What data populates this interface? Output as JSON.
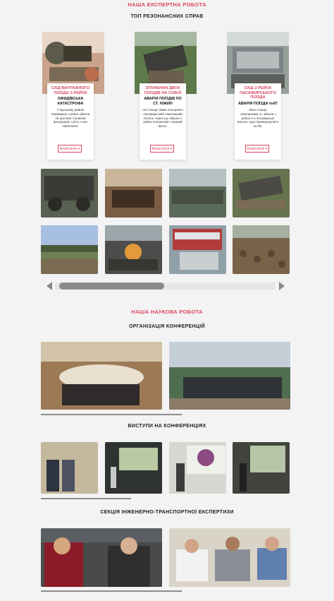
{
  "expert": {
    "heading": "НАША ЕКСПЕРТНА РОБОТА",
    "subheading": "ТОП РЕЗОНАНСНИХ СПРАВ",
    "cards": [
      {
        "red": "СХІД ВАНТАЖНОГО ПОЇЗДА З РЕЙОК",
        "bold": "ОЖИДІВСЬКА КАТАСТРОФА",
        "text": "У Буському районі Львівщини з рейок зійшли 15 цистерн з жовтим фосфором, шість з них зайнялися.",
        "button": "Read more"
      },
      {
        "red": "ЗІТКНЕННЯ ДВОХ ПОЇЗДІВ НА СОБОЇ",
        "bold": "АВАРІЯ ПОЇЗДІВ ПО СТ. НІЖИН",
        "text": "На станції Ніжин зіткнулися пасажирський і вантажний потяги, через що зійшли з рейок локомотив і перший вагон.",
        "button": "Read more"
      },
      {
        "red": "СХІД З РЕЙОК ПАСАЖИРСЬКОГО ПОЇЗДА",
        "bold": "АВАРІЯ ПОЇЗДА №87",
        "text": "Біля станції «Запорожжя-1» зійшли з рейок 4-а пасажирські вагони, одні перевернулися на бік.",
        "button": "Read more"
      }
    ]
  },
  "science": {
    "heading": "НАША НАУКОВА РОБОТА",
    "conferences_title": "ОРГАНІЗАЦІЯ КОНФЕРЕНЦІЙ",
    "talks_title": "ВИСТУПИ НА КОНФЕРЕНЦІЯХ",
    "section_title": "СЕКЦІЯ ІНЖЕНЕРНО-ТРАНСПОРТНОЇ ЕКСПЕРТИЗИ"
  },
  "icons": {
    "left": "chevron-left-icon",
    "right": "chevron-right-icon",
    "more": "chevron-down-icon"
  },
  "colors": {
    "accent": "#d9455f",
    "background": "#f4f3f3"
  }
}
